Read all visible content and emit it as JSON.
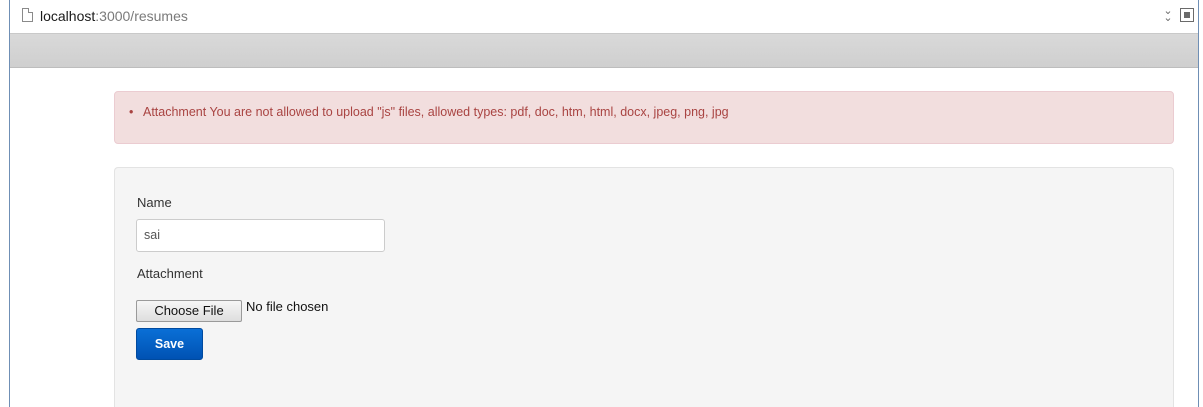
{
  "browser": {
    "url_host": "localhost",
    "url_path": ":3000/resumes",
    "icons": [
      "page-icon",
      "double-chevron-icon",
      "stop-icon"
    ]
  },
  "alert": {
    "message": "Attachment You are not allowed to upload \"js\" files, allowed types: pdf, doc, htm, html, docx, jpeg, png, jpg",
    "background": "#f2dede",
    "text_color": "#a94442"
  },
  "form": {
    "name_label": "Name",
    "name_value": "sai",
    "attachment_label": "Attachment",
    "choose_file_label": "Choose File",
    "no_file_text": "No file chosen",
    "save_label": "Save",
    "save_color": "#0a6fd6"
  }
}
